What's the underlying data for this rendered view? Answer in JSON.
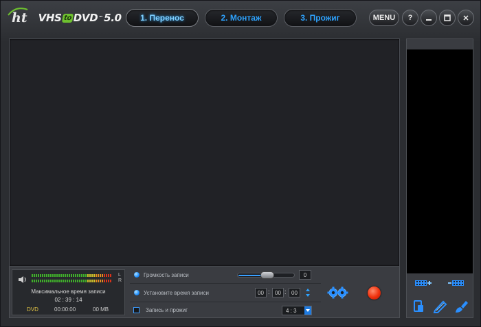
{
  "app": {
    "logo_ht": "ht",
    "logo_prefix": "VHS",
    "logo_to": "to",
    "logo_suffix": "DVD",
    "logo_tm": "™",
    "logo_version": "5.0"
  },
  "steps": [
    {
      "label": "1. Перенос",
      "active": true
    },
    {
      "label": "2. Монтаж",
      "active": false
    },
    {
      "label": "3. Прожиг",
      "active": false
    }
  ],
  "window": {
    "menu_label": "MENU",
    "help_label": "?",
    "minimize_label": "_",
    "close_label": "✕"
  },
  "meter": {
    "left_channel": "L",
    "right_channel": "R",
    "max_time_label": "Максимальное время записи",
    "max_time_value": "02 : 39 : 14",
    "disc_type": "DVD",
    "timecode": "00:00:00",
    "size": "00 MB"
  },
  "options": {
    "volume_label": "Громкость записи",
    "volume_value": "0",
    "volume_level": 0.45,
    "set_time_label": "Установите время записи",
    "time_h": "00",
    "time_m": "00",
    "time_s": "00",
    "record_burn_label": "Запись и прожиг",
    "record_burn_checked": false,
    "aspect_ratio": "4 : 3"
  },
  "colors": {
    "accent": "#2ea3ff",
    "record": "#f0300c",
    "logo_green": "#6ec12f"
  },
  "icons": {
    "add_clip": "film-add-icon",
    "remove_clip": "film-remove-icon",
    "copy": "copy-device-icon",
    "edit": "pencil-icon",
    "clean": "brush-icon"
  }
}
